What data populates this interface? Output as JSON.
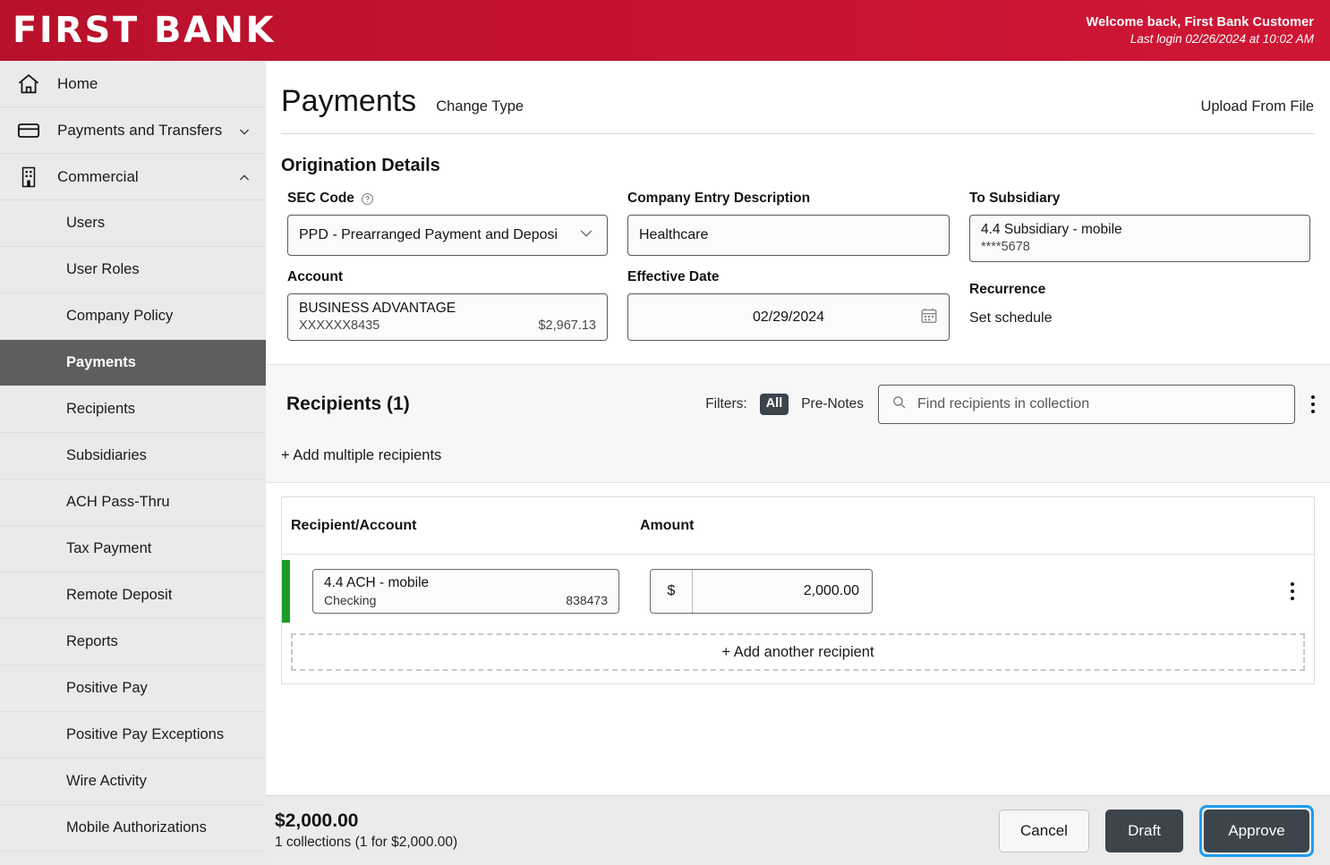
{
  "header": {
    "brand": "FIRST BANK",
    "welcome": "Welcome back, First Bank Customer",
    "last_login": "Last login 02/26/2024 at 10:02 AM",
    "brand_color": "#c41230"
  },
  "sidebar": {
    "items": [
      {
        "label": "Home",
        "icon": "home-icon",
        "level": "top",
        "expandable": false
      },
      {
        "label": "Payments and Transfers",
        "icon": "card-icon",
        "level": "top",
        "expandable": true,
        "state": "collapsed"
      },
      {
        "label": "Commercial",
        "icon": "building-icon",
        "level": "top",
        "expandable": true,
        "state": "expanded"
      },
      {
        "label": "Users",
        "level": "sub"
      },
      {
        "label": "User Roles",
        "level": "sub"
      },
      {
        "label": "Company Policy",
        "level": "sub"
      },
      {
        "label": "Payments",
        "level": "sub",
        "active": true
      },
      {
        "label": "Recipients",
        "level": "sub"
      },
      {
        "label": "Subsidiaries",
        "level": "sub"
      },
      {
        "label": "ACH Pass-Thru",
        "level": "sub"
      },
      {
        "label": "Tax Payment",
        "level": "sub"
      },
      {
        "label": "Remote Deposit",
        "level": "sub"
      },
      {
        "label": "Reports",
        "level": "sub"
      },
      {
        "label": "Positive Pay",
        "level": "sub"
      },
      {
        "label": "Positive Pay Exceptions",
        "level": "sub"
      },
      {
        "label": "Wire Activity",
        "level": "sub"
      },
      {
        "label": "Mobile Authorizations",
        "level": "sub"
      }
    ],
    "active_color": "#5e5e5e"
  },
  "page": {
    "title": "Payments",
    "change_type": "Change Type",
    "upload_from_file": "Upload From File"
  },
  "origination": {
    "section_title": "Origination Details",
    "sec_code": {
      "label": "SEC Code",
      "value": "PPD - Prearranged Payment and Deposi",
      "help_icon": "question-circle-icon",
      "caret_icon": "chevron-down-icon"
    },
    "company_entry_description": {
      "label": "Company Entry Description",
      "value": "Healthcare"
    },
    "to_subsidiary": {
      "label": "To Subsidiary",
      "name": "4.4 Subsidiary - mobile",
      "masked": "****5678"
    },
    "account": {
      "label": "Account",
      "name": "BUSINESS ADVANTAGE",
      "number": "XXXXXX8435",
      "balance": "$2,967.13"
    },
    "effective_date": {
      "label": "Effective Date",
      "value": "02/29/2024",
      "icon": "calendar-icon"
    },
    "recurrence": {
      "label": "Recurrence",
      "action": "Set schedule"
    }
  },
  "recipients": {
    "title": "Recipients (1)",
    "filters_label": "Filters:",
    "filter_all": "All",
    "filter_pre_notes": "Pre-Notes",
    "search_placeholder": "Find recipients in collection",
    "search_value": "",
    "search_icon": "search-icon",
    "menu_icon": "kebab-menu-icon",
    "add_multiple": "+ Add multiple recipients",
    "add_another": "+ Add another recipient",
    "columns": [
      "Recipient/Account",
      "Amount"
    ],
    "rows": [
      {
        "name": "4.4 ACH - mobile",
        "account_type": "Checking",
        "account_number": "838473",
        "currency": "$",
        "amount": "2,000.00",
        "flag_color": "#1a9c26"
      }
    ]
  },
  "footer": {
    "total": "$2,000.00",
    "summary": "1 collections (1 for $2,000.00)",
    "cancel": "Cancel",
    "draft": "Draft",
    "approve": "Approve",
    "focus_color": "#1f9cf0"
  }
}
